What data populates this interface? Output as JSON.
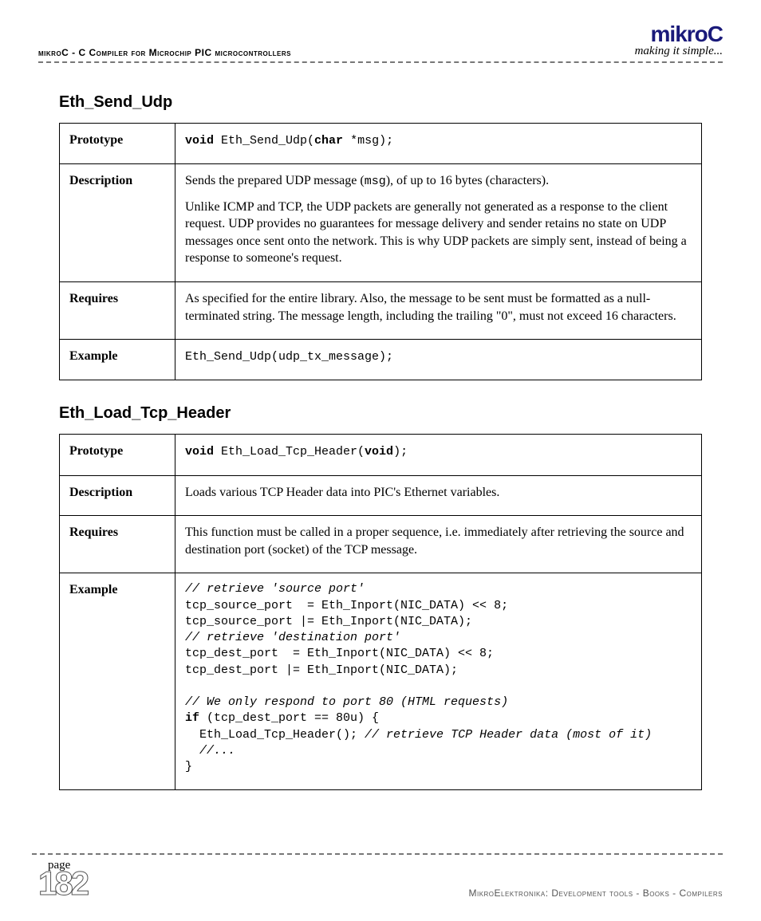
{
  "header": {
    "left": "mikroC - C Compiler for Microchip PIC microcontrollers",
    "brand": "mikroC",
    "tagline": "making it simple..."
  },
  "sections": [
    {
      "title": "Eth_Send_Udp",
      "rows": {
        "proto_label": "Prototype",
        "proto_pre": "void",
        "proto_mid": " Eth_Send_Udp(",
        "proto_kw2": "char",
        "proto_post": " *msg);",
        "desc_label": "Description",
        "desc_p1a": "Sends the prepared UDP message (",
        "desc_p1_code": "msg",
        "desc_p1b": "), of up to 16 bytes (characters).",
        "desc_p2": "Unlike ICMP and TCP, the UDP packets are generally not generated as a response to the client request. UDP provides no guarantees for message delivery and sender retains no state on UDP messages once sent onto the network. This is why UDP packets are simply sent, instead of being a response to someone's request.",
        "req_label": "Requires",
        "req": "As specified for the entire library. Also, the message to be sent must be formatted as a null-terminated string. The message length, including the trailing \"0\", must not exceed 16 characters.",
        "ex_label": "Example",
        "ex_code": "Eth_Send_Udp(udp_tx_message);"
      }
    },
    {
      "title": "Eth_Load_Tcp_Header",
      "rows": {
        "proto_label": "Prototype",
        "proto_pre": "void",
        "proto_mid": " Eth_Load_Tcp_Header(",
        "proto_kw2": "void",
        "proto_post": ");",
        "desc_label": "Description",
        "desc": "Loads various TCP Header data into PIC's Ethernet variables.",
        "req_label": "Requires",
        "req": "This function must be called in a proper sequence, i.e. immediately after retrieving the source and destination port (socket) of the TCP message.",
        "ex_label": "Example",
        "code": {
          "c1": "// retrieve 'source port'",
          "l2": "tcp_source_port  = Eth_Inport(NIC_DATA) << 8;",
          "l3": "tcp_source_port |= Eth_Inport(NIC_DATA);",
          "c4": "// retrieve 'destination port'",
          "l5": "tcp_dest_port  = Eth_Inport(NIC_DATA) << 8;",
          "l6": "tcp_dest_port |= Eth_Inport(NIC_DATA);",
          "blank": "",
          "c7": "// We only respond to port 80 (HTML requests)",
          "l8a": "if",
          "l8b": " (tcp_dest_port == 80u) {",
          "l9a": "  Eth_Load_Tcp_Header(); ",
          "l9b": "// retrieve TCP Header data (most of it)",
          "l10": "  //...",
          "l11": "}"
        }
      }
    }
  ],
  "footer": {
    "page_word": "page",
    "page_num": "182",
    "publisher": "MikroElektronika: Development tools - Books - Compilers"
  }
}
